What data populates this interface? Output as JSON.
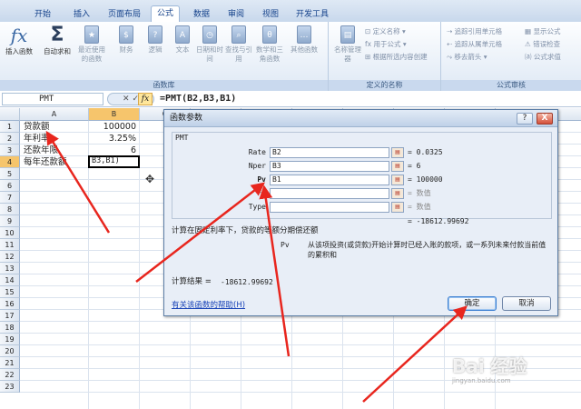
{
  "tabs": [
    "开始",
    "插入",
    "页面布局",
    "公式",
    "数据",
    "审阅",
    "视图",
    "开发工具"
  ],
  "active_tab": "公式",
  "ribbon": {
    "function_library": {
      "label": "函数库",
      "insert_function": "插入函数",
      "autosum": "自动求和",
      "recent": "最近使用的函数",
      "financial": "财务",
      "logical": "逻辑",
      "text": "文本",
      "datetime": "日期和时间",
      "lookup": "查找与引用",
      "math": "数学和三角函数",
      "more": "其他函数"
    },
    "defined_names": {
      "label": "定义的名称",
      "name_manager": "名称管理器",
      "define_name": "定义名称",
      "use_in_formula": "用于公式",
      "create_from_selection": "根据所选内容创建"
    },
    "formula_auditing": {
      "label": "公式审核",
      "trace_precedents": "追踪引用单元格",
      "trace_dependents": "追踪从属单元格",
      "remove_arrows": "移去箭头",
      "show_formulas": "显示公式",
      "error_checking": "错误检查",
      "evaluate_formula": "公式求值"
    }
  },
  "formula_bar": {
    "name_box": "PMT",
    "formula": "=PMT(B2,B3,B1)"
  },
  "sheet": {
    "columns": [
      "A",
      "B",
      "C",
      "D",
      "E",
      "F",
      "G",
      "H",
      "I",
      "J"
    ],
    "rows": [
      "1",
      "2",
      "3",
      "4",
      "5",
      "6",
      "7",
      "8",
      "9",
      "10",
      "11",
      "12",
      "13",
      "14",
      "15",
      "16",
      "17",
      "18",
      "19",
      "20",
      "21",
      "22",
      "23"
    ],
    "cells": {
      "A1": "贷款额",
      "B1": "100000",
      "A2": "年利率",
      "B2": "3.25%",
      "A3": "还款年限",
      "B3": "6",
      "A4": "每年还款额",
      "B4": "B3,B1)"
    }
  },
  "dialog": {
    "title": "函数参数",
    "help_btn": "?",
    "close_btn": "X",
    "function_name": "PMT",
    "args": [
      {
        "label": "Rate",
        "value": "B2",
        "result": "= 0.0325",
        "empty": false
      },
      {
        "label": "Nper",
        "value": "B3",
        "result": "= 6",
        "empty": false
      },
      {
        "label": "Pv",
        "value": "B1",
        "result": "= 100000",
        "empty": false
      },
      {
        "label": "Fv",
        "value": "",
        "result": "= 数值",
        "empty": true
      },
      {
        "label": "Type",
        "value": "",
        "result": "= 数值",
        "empty": true
      }
    ],
    "total": "= -18612.99692",
    "description": "计算在固定利率下，贷款的等额分期偿还额",
    "arg_name": "Pv",
    "arg_description": "从该项投资(或贷款)开始计算时已经入账的款项，或一系列未来付款当前值的累积和",
    "result_label": "计算结果 =",
    "result_value": "-18612.99692",
    "help_link": "有关该函数的帮助(H)",
    "ok": "确定",
    "cancel": "取消"
  },
  "watermark": {
    "brand": "Bai 经验",
    "site": "jingyan.baidu.com"
  },
  "colors": {
    "annotation_arrow": "#e8261e",
    "ribbon_bg": "#dfe9f5",
    "selected_header": "#f6c56c"
  }
}
